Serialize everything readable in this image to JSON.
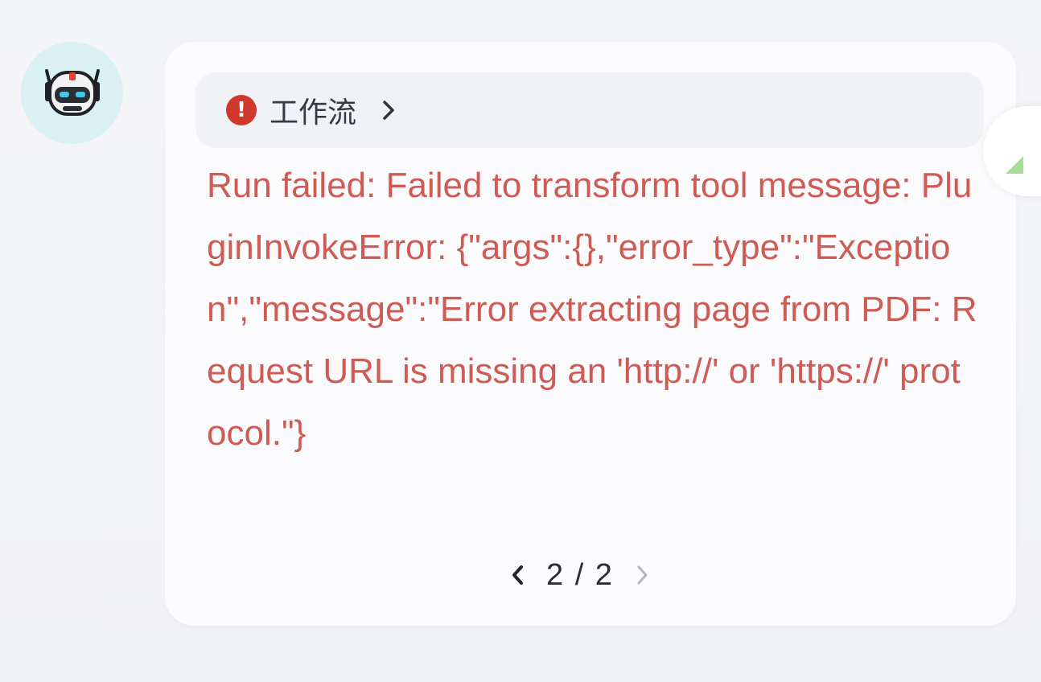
{
  "avatar": {
    "icon": "robot-icon",
    "bg_color": "#d9f1f3"
  },
  "workflow": {
    "label": "工作流",
    "status_icon": "error-icon",
    "status_color": "#d0382d",
    "expand_icon": "chevron-right-icon"
  },
  "message": {
    "error_text": "Run failed: Failed to transform tool message: PluginInvokeError: {\"args\":{},\"error_type\":\"Exception\",\"message\":\"Error extracting page from PDF: Request URL is missing an 'http://' or 'https://' protocol.\"}",
    "text_color": "#cf5b55"
  },
  "pagination": {
    "current": "2",
    "total": "2",
    "label": "2 / 2",
    "prev_icon": "chevron-left-icon",
    "next_icon": "chevron-right-icon",
    "next_enabled": false
  },
  "side_fab": {
    "icon": "triangle-marker-icon",
    "color": "#a6dc9a"
  }
}
